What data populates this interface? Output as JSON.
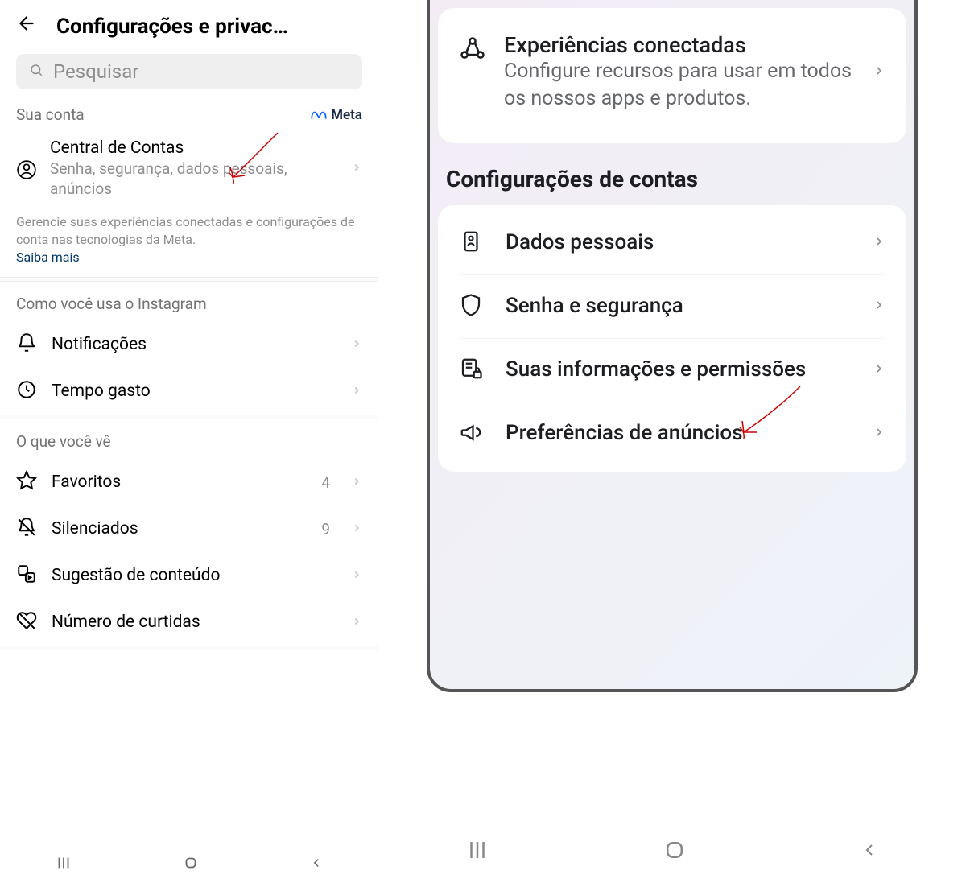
{
  "left": {
    "header_title": "Configurações e privac…",
    "search_placeholder": "Pesquisar",
    "account_section": "Sua conta",
    "meta_label": "Meta",
    "cc_title": "Central de Contas",
    "cc_sub": "Senha, segurança, dados pessoais, anúncios",
    "manage": "Gerencie suas experiências conectadas e configurações de conta nas tecnologias da Meta.",
    "learn_more": "Saiba mais",
    "how_use": "Como você usa o Instagram",
    "notifications": "Notificações",
    "time": "Tempo gasto",
    "what_see": "O que você vê",
    "favorites": "Favoritos",
    "fav_count": "4",
    "muted": "Silenciados",
    "muted_count": "9",
    "suggestions": "Sugestão de conteúdo",
    "likes": "Número de curtidas"
  },
  "right": {
    "exp_title": "Experiências conectadas",
    "exp_sub": "Configure recursos para usar em todos os nossos apps e produtos.",
    "section": "Configurações de contas",
    "personal": "Dados pessoais",
    "password": "Senha e segurança",
    "info_perm": "Suas informações e permissões",
    "ads": "Preferências de anúncios"
  }
}
